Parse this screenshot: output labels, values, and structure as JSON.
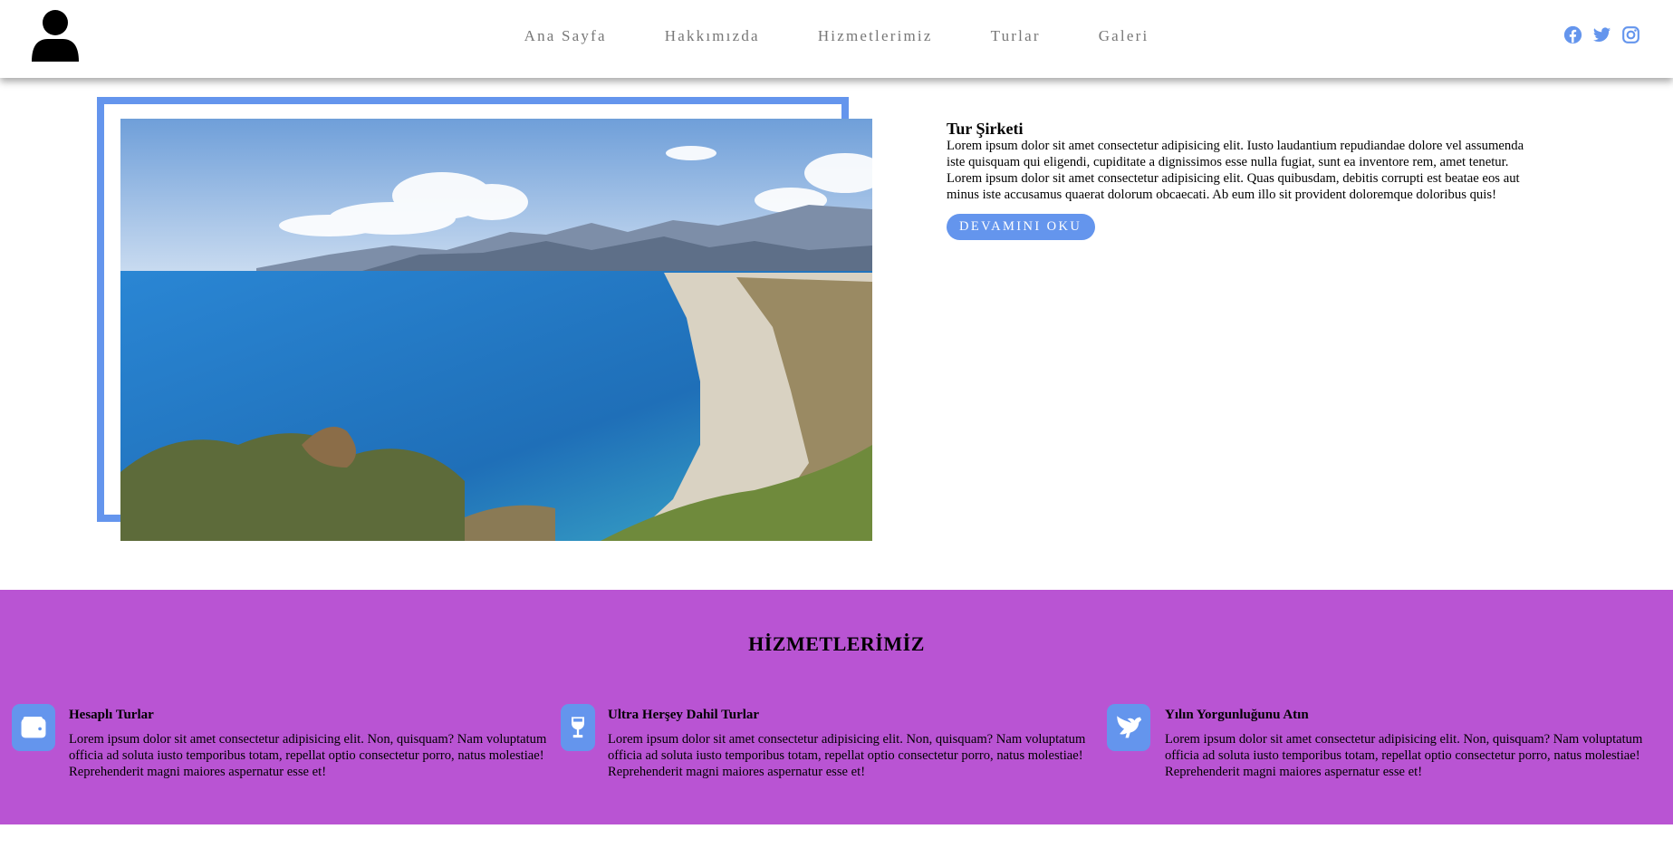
{
  "header": {
    "logo_icon": "user-icon",
    "nav": [
      {
        "label": "Ana Sayfa"
      },
      {
        "label": "Hakkımızda"
      },
      {
        "label": "Hizmetlerimiz"
      },
      {
        "label": "Turlar"
      },
      {
        "label": "Galeri"
      }
    ],
    "social_icons": [
      "facebook-icon",
      "twitter-icon",
      "instagram-icon"
    ]
  },
  "about": {
    "image_alt": "coastal-beach-photo",
    "title": "Tur Şirketi",
    "text": "Lorem ipsum dolor sit amet consectetur adipisicing elit. Iusto laudantium repudiandae dolore vel assumenda iste quisquam qui eligendi, cupiditate a dignissimos esse nulla fugiat, sunt ea inventore rem, amet tenetur. Lorem ipsum dolor sit amet consectetur adipisicing elit. Quas quibusdam, debitis corrupti est beatae eos aut minus iste accusamus quaerat dolorum obcaecati. Ab eum illo sit provident doloremque doloribus quis!",
    "button": "DEVAMINI OKU"
  },
  "services": {
    "title": "HİZMETLERİMİZ",
    "items": [
      {
        "icon": "wallet-icon",
        "title": "Hesaplı Turlar",
        "text": "Lorem ipsum dolor sit amet consectetur adipisicing elit. Non, quisquam? Nam voluptatum officia ad soluta iusto temporibus totam, repellat optio consectetur porro, natus molestiae! Reprehenderit magni maiores aspernatur esse et!"
      },
      {
        "icon": "wine-glass-icon",
        "title": "Ultra Herşey Dahil Turlar",
        "text": "Lorem ipsum dolor sit amet consectetur adipisicing elit. Non, quisquam? Nam voluptatum officia ad soluta iusto temporibus totam, repellat optio consectetur porro, natus molestiae! Reprehenderit magni maiores aspernatur esse et!"
      },
      {
        "icon": "dove-icon",
        "title": "Yılın Yorgunluğunu Atın",
        "text": "Lorem ipsum dolor sit amet consectetur adipisicing elit. Non, quisquam? Nam voluptatum officia ad soluta iusto temporibus totam, repellat optio consectetur porro, natus molestiae! Reprehenderit magni maiores aspernatur esse et!"
      }
    ]
  },
  "colors": {
    "accent": "#6495ed",
    "services_bg": "#b954d3",
    "nav_text": "#777777"
  }
}
